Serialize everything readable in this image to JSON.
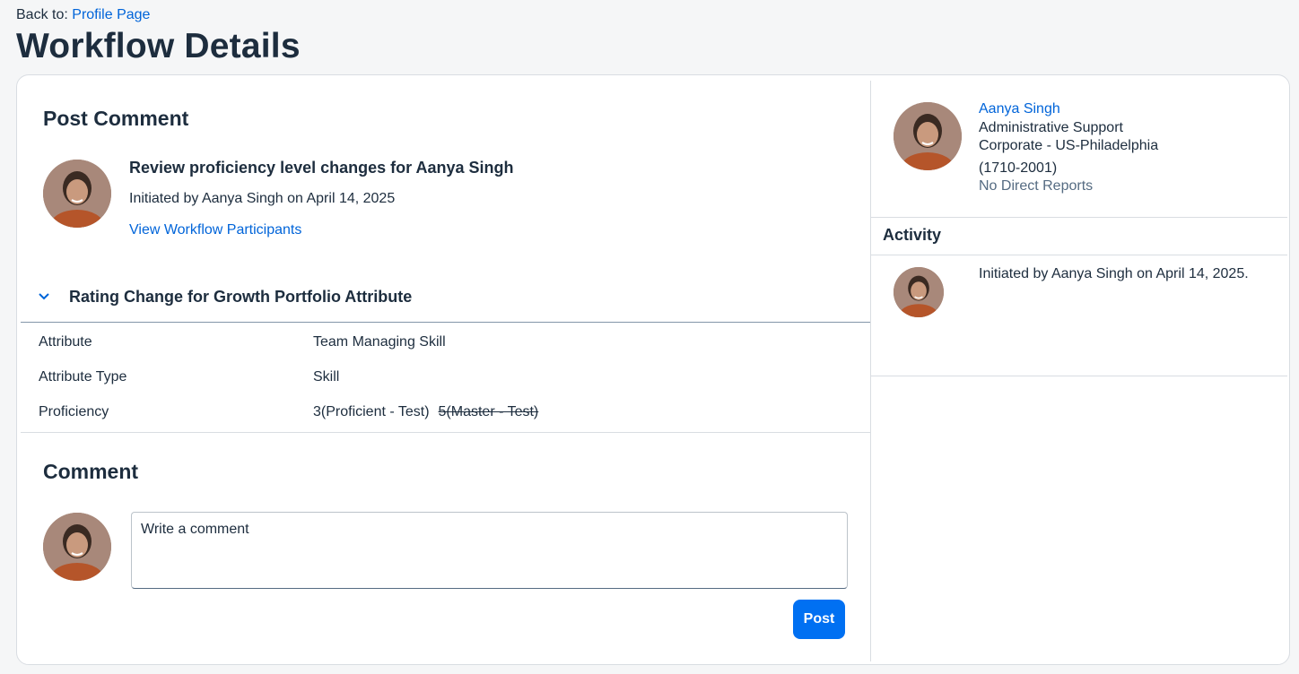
{
  "header": {
    "back_prefix": "Back to:",
    "back_link": "Profile Page",
    "title": "Workflow Details"
  },
  "post": {
    "title": "Post Comment",
    "workflow_title": "Review proficiency level changes for Aanya Singh",
    "initiated": "Initiated by Aanya Singh on April 14, 2025",
    "participants_link": "View Workflow Participants"
  },
  "rating": {
    "section_title": "Rating Change for Growth Portfolio Attribute",
    "rows": [
      {
        "label": "Attribute",
        "value": "Team Managing Skill"
      },
      {
        "label": "Attribute Type",
        "value": "Skill"
      },
      {
        "label": "Proficiency",
        "value": "3(Proficient - Test)",
        "old_value": "5(Master - Test)"
      }
    ]
  },
  "comment": {
    "title": "Comment",
    "placeholder": "Write a comment",
    "post_label": "Post"
  },
  "profile": {
    "name": "Aanya Singh",
    "role": "Administrative Support",
    "location": "Corporate - US-Philadelphia",
    "code": "(1710-2001)",
    "reports": "No Direct Reports"
  },
  "activity": {
    "title": "Activity",
    "items": [
      {
        "text": "Initiated by Aanya Singh on April 14, 2025."
      }
    ]
  },
  "colors": {
    "accent": "#0064d9",
    "button": "#0070f2",
    "text": "#1d2d3e",
    "muted": "#556b82",
    "background": "#f5f6f7"
  }
}
